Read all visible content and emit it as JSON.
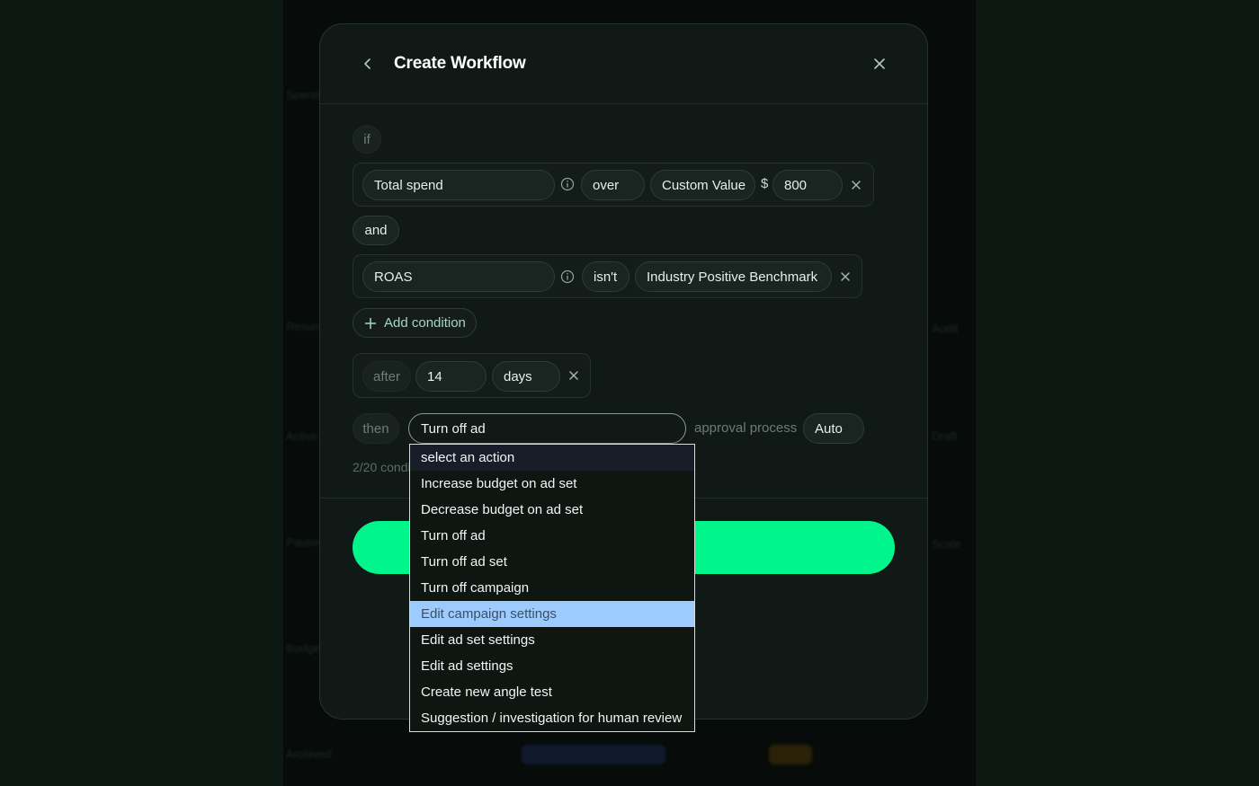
{
  "background": {
    "ghost_texts": [
      "Spend",
      "Resume",
      "Active",
      "Paused",
      "Budget",
      "Audit",
      "Draft",
      "Scale",
      "Archived"
    ]
  },
  "modal": {
    "title": "Create Workflow",
    "back_icon": "chevron-left-icon",
    "close_icon": "close-icon"
  },
  "if_label": "if",
  "condition1": {
    "metric": "Total spend",
    "operator": "over",
    "value_type": "Custom Value",
    "currency": "$",
    "value": "800"
  },
  "and_label": "and",
  "condition2": {
    "metric": "ROAS",
    "operator": "isn't",
    "value_type": "Industry Positive Benchmark"
  },
  "add_condition_label": "Add condition",
  "after": {
    "label": "after",
    "value": "14",
    "unit": "days"
  },
  "then": {
    "label": "then",
    "action": "Turn off ad",
    "approval_label": "approval process",
    "approval_value": "Auto"
  },
  "conditions_count": "2/20 condi",
  "dropdown": {
    "options": [
      "select an action",
      "Increase budget on ad set",
      "Decrease budget on ad set",
      "Turn off ad",
      "Turn off ad set",
      "Turn off campaign",
      "Edit campaign settings",
      "Edit ad set settings",
      "Edit ad settings",
      "Create new angle test",
      "Suggestion / investigation for human review"
    ],
    "highlighted_index": 6
  },
  "colors": {
    "accent": "#00f58a",
    "highlight": "#9ecbff"
  }
}
